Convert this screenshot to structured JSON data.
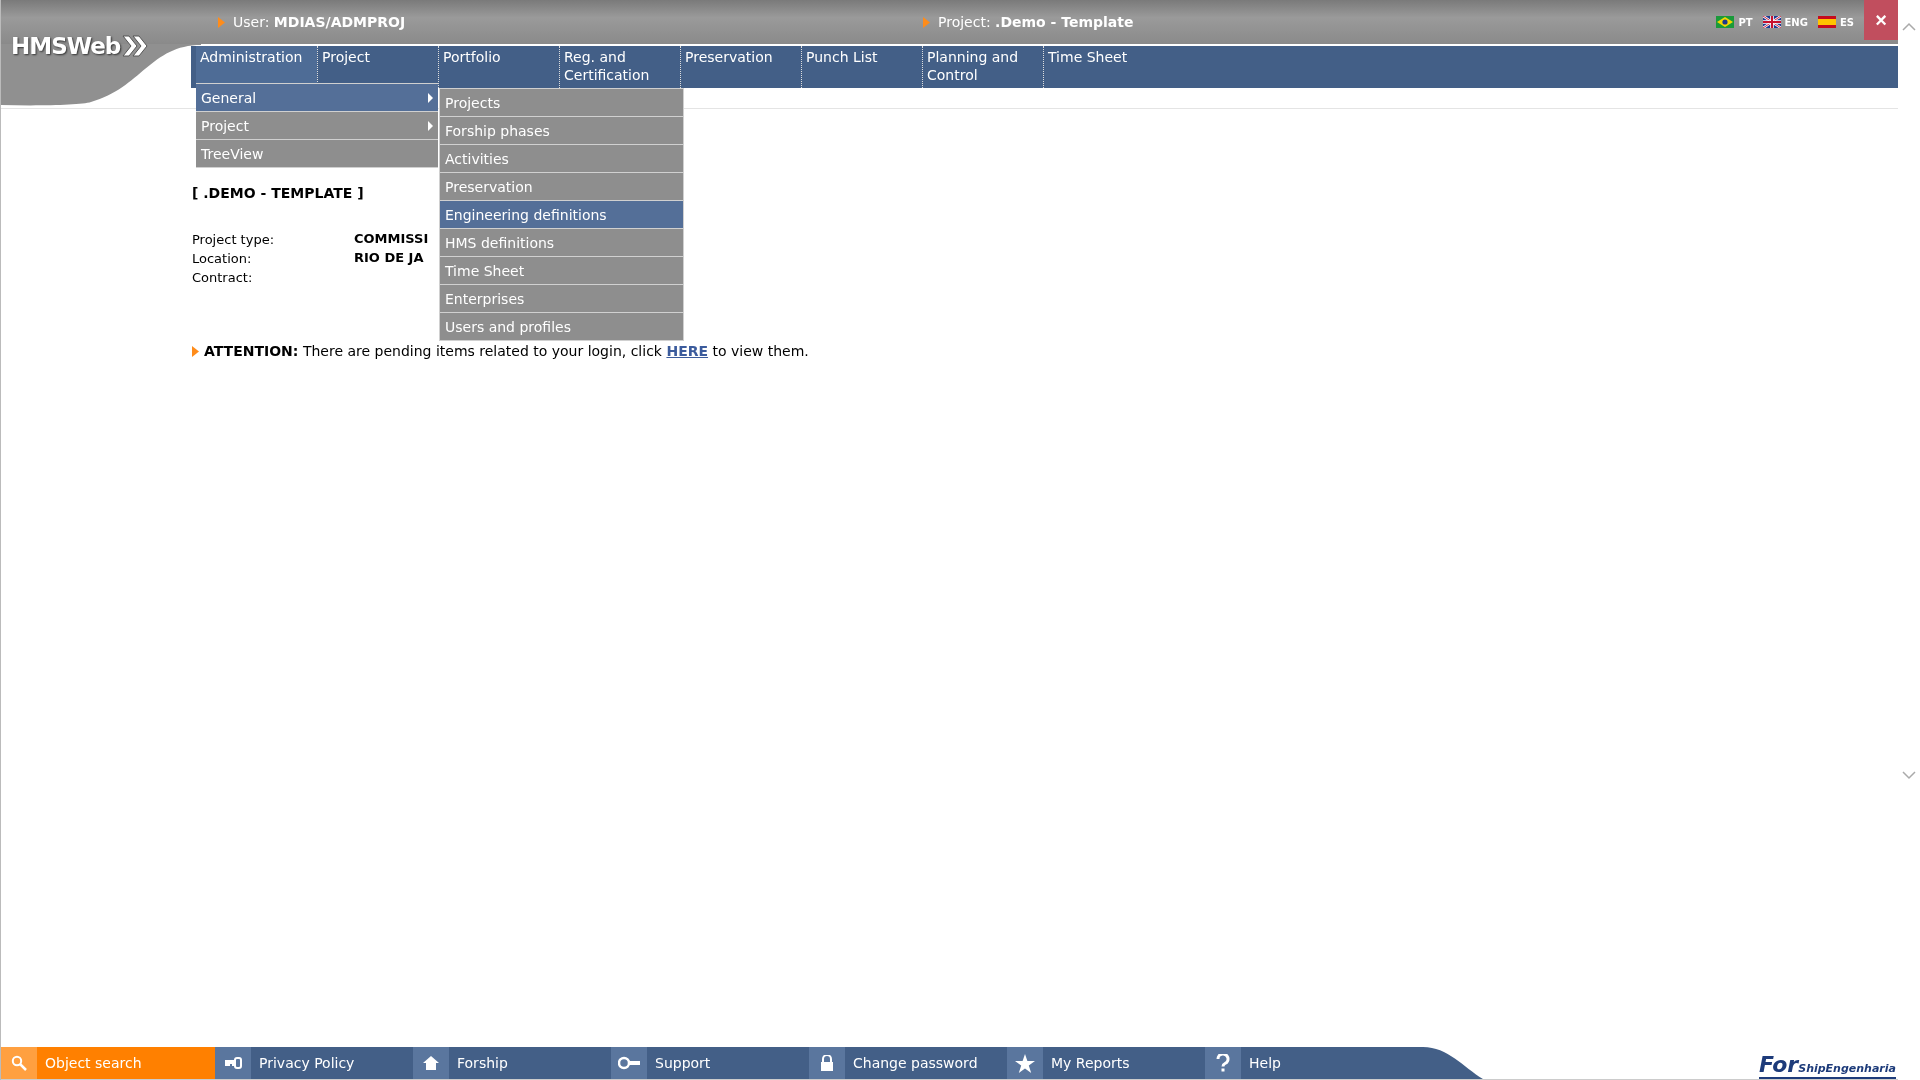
{
  "logo": {
    "text": "HMSWeb"
  },
  "header": {
    "user_label": "User:",
    "user": "MDIAS/ADMPROJ",
    "project_label": "Project:",
    "project": ".Demo - Template",
    "languages": [
      {
        "code": "PT",
        "kind": "br"
      },
      {
        "code": "ENG",
        "kind": "uk"
      },
      {
        "code": "ES",
        "kind": "es"
      }
    ],
    "close": "×"
  },
  "nav": [
    {
      "label": "Administration",
      "selected": true
    },
    {
      "label": "Project",
      "selected": false
    },
    {
      "label": "Portfolio",
      "selected": false
    },
    {
      "label": "Reg. and Certification",
      "selected": false
    },
    {
      "label": "Preservation",
      "selected": false
    },
    {
      "label": "Punch List",
      "selected": false
    },
    {
      "label": "Planning and Control",
      "selected": false
    },
    {
      "label": "Time Sheet",
      "selected": false
    }
  ],
  "menu": [
    {
      "label": "General",
      "selected": true,
      "submenu": true
    },
    {
      "label": "Project",
      "selected": false,
      "submenu": true
    },
    {
      "label": "TreeView",
      "selected": false,
      "submenu": false
    }
  ],
  "submenu": [
    {
      "label": "Projects",
      "selected": false
    },
    {
      "label": "Forship phases",
      "selected": false
    },
    {
      "label": "Activities",
      "selected": false
    },
    {
      "label": "Preservation",
      "selected": false
    },
    {
      "label": "Engineering definitions",
      "selected": true
    },
    {
      "label": "HMS definitions",
      "selected": false
    },
    {
      "label": "Time Sheet",
      "selected": false
    },
    {
      "label": "Enterprises",
      "selected": false
    },
    {
      "label": "Users and profiles",
      "selected": false
    }
  ],
  "content": {
    "title": "[ .DEMO - TEMPLATE ]",
    "fields": [
      {
        "label": "Project type:",
        "value": "COMMISSI"
      },
      {
        "label": "Location:",
        "value": "RIO DE JA"
      },
      {
        "label": "Contract:"
      }
    ],
    "attention": {
      "label": "ATTENTION:",
      "text": "There are pending items related to your login, click",
      "link": "HERE",
      "after": "to view them."
    }
  },
  "footer": [
    {
      "label": "Object search",
      "kind": "search",
      "selected": true
    },
    {
      "label": "Privacy Policy",
      "kind": "key",
      "selected": false
    },
    {
      "label": "Forship",
      "kind": "home",
      "selected": false
    },
    {
      "label": "Support",
      "kind": "wrench",
      "selected": false
    },
    {
      "label": "Change password",
      "kind": "lock",
      "selected": false
    },
    {
      "label": "My Reports",
      "kind": "star",
      "selected": false
    },
    {
      "label": "Help",
      "kind": "help",
      "selected": false
    }
  ],
  "brand": {
    "main": "For",
    "sub": "Ship",
    "tail": "Engenharia"
  }
}
